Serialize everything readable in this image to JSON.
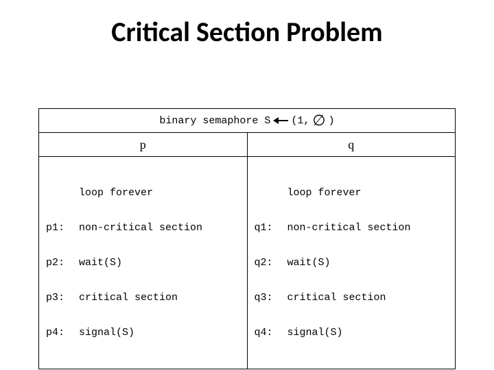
{
  "title": "Critical Section Problem",
  "decl": {
    "prefix": "binary semaphore S",
    "tuple_open": "(1,",
    "tuple_close": ")",
    "empty_set_symbol": "∅",
    "arrow_desc": "left-arrow"
  },
  "columns": {
    "p": {
      "header": "p",
      "loop": "loop forever",
      "lines": [
        {
          "label": "p1:",
          "stmt": "non-critical section"
        },
        {
          "label": "p2:",
          "stmt": "wait(S)"
        },
        {
          "label": "p3:",
          "stmt": "critical section"
        },
        {
          "label": "p4:",
          "stmt": "signal(S)"
        }
      ]
    },
    "q": {
      "header": "q",
      "loop": "loop forever",
      "lines": [
        {
          "label": "q1:",
          "stmt": "non-critical section"
        },
        {
          "label": "q2:",
          "stmt": "wait(S)"
        },
        {
          "label": "q3:",
          "stmt": "critical section"
        },
        {
          "label": "q4:",
          "stmt": "signal(S)"
        }
      ]
    }
  }
}
